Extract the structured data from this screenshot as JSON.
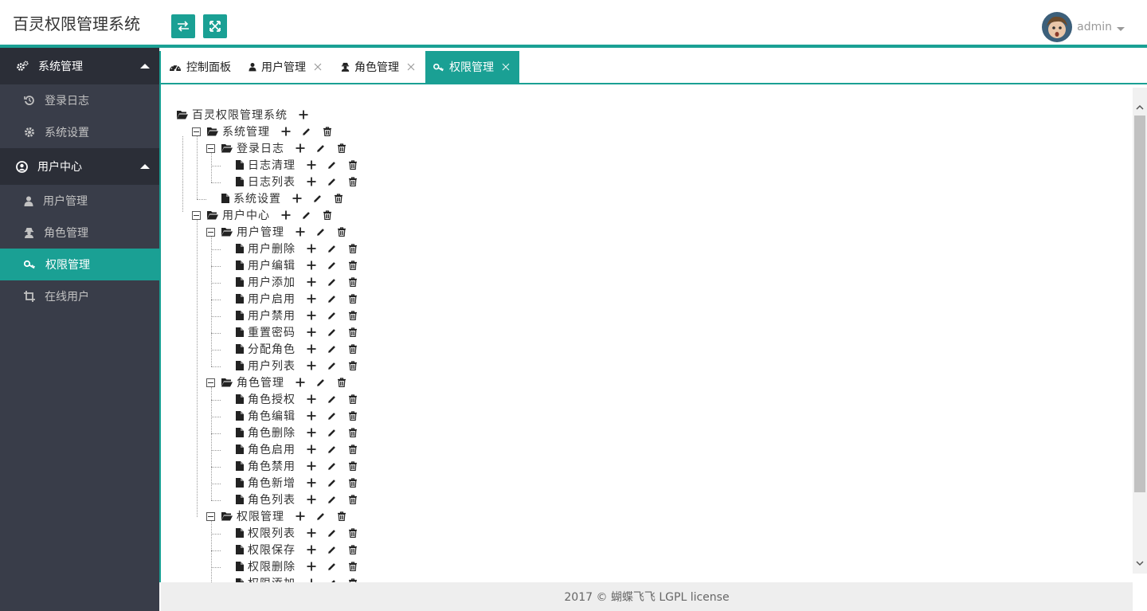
{
  "header": {
    "title": "百灵权限管理系统",
    "buttons": [
      {
        "icon": "swap-icon"
      },
      {
        "icon": "expand-icon"
      }
    ],
    "user": {
      "name": "admin"
    }
  },
  "sidebar": {
    "groups": [
      {
        "label": "系统管理",
        "icon": "cogs-icon",
        "items": [
          {
            "label": "登录日志",
            "icon": "history-icon"
          },
          {
            "label": "系统设置",
            "icon": "gear-icon"
          }
        ]
      },
      {
        "label": "用户中心",
        "icon": "user-circle-icon",
        "items": [
          {
            "label": "用户管理",
            "icon": "user-icon"
          },
          {
            "label": "角色管理",
            "icon": "user-secret-icon"
          },
          {
            "label": "权限管理",
            "icon": "key-icon",
            "active": true
          },
          {
            "label": "在线用户",
            "icon": "crop-icon"
          }
        ]
      }
    ]
  },
  "tabs": [
    {
      "label": "控制面板",
      "icon": "dashboard-icon",
      "closable": false
    },
    {
      "label": "用户管理",
      "icon": "user-icon",
      "closable": true
    },
    {
      "label": "角色管理",
      "icon": "user-secret-icon",
      "closable": true
    },
    {
      "label": "权限管理",
      "icon": "key-icon",
      "closable": true,
      "active": true
    }
  ],
  "tree": [
    {
      "label": "百灵权限管理系统",
      "type": "folder",
      "level": 0,
      "actions": [
        "add"
      ]
    },
    {
      "label": "系统管理",
      "type": "folder",
      "level": 1,
      "actions": [
        "add",
        "edit",
        "delete"
      ]
    },
    {
      "label": "登录日志",
      "type": "folder",
      "level": 2,
      "actions": [
        "add",
        "edit",
        "delete"
      ]
    },
    {
      "label": "日志清理",
      "type": "file",
      "level": 3,
      "actions": [
        "add",
        "edit",
        "delete"
      ]
    },
    {
      "label": "日志列表",
      "type": "file",
      "level": 3,
      "actions": [
        "add",
        "edit",
        "delete"
      ]
    },
    {
      "label": "系统设置",
      "type": "file",
      "level": 2,
      "actions": [
        "add",
        "edit",
        "delete"
      ]
    },
    {
      "label": "用户中心",
      "type": "folder",
      "level": 1,
      "actions": [
        "add",
        "edit",
        "delete"
      ]
    },
    {
      "label": "用户管理",
      "type": "folder",
      "level": 2,
      "actions": [
        "add",
        "edit",
        "delete"
      ]
    },
    {
      "label": "用户删除",
      "type": "file",
      "level": 3,
      "actions": [
        "add",
        "edit",
        "delete"
      ]
    },
    {
      "label": "用户编辑",
      "type": "file",
      "level": 3,
      "actions": [
        "add",
        "edit",
        "delete"
      ]
    },
    {
      "label": "用户添加",
      "type": "file",
      "level": 3,
      "actions": [
        "add",
        "edit",
        "delete"
      ]
    },
    {
      "label": "用户启用",
      "type": "file",
      "level": 3,
      "actions": [
        "add",
        "edit",
        "delete"
      ]
    },
    {
      "label": "用户禁用",
      "type": "file",
      "level": 3,
      "actions": [
        "add",
        "edit",
        "delete"
      ]
    },
    {
      "label": "重置密码",
      "type": "file",
      "level": 3,
      "actions": [
        "add",
        "edit",
        "delete"
      ]
    },
    {
      "label": "分配角色",
      "type": "file",
      "level": 3,
      "actions": [
        "add",
        "edit",
        "delete"
      ]
    },
    {
      "label": "用户列表",
      "type": "file",
      "level": 3,
      "actions": [
        "add",
        "edit",
        "delete"
      ]
    },
    {
      "label": "角色管理",
      "type": "folder",
      "level": 2,
      "actions": [
        "add",
        "edit",
        "delete"
      ]
    },
    {
      "label": "角色授权",
      "type": "file",
      "level": 3,
      "actions": [
        "add",
        "edit",
        "delete"
      ]
    },
    {
      "label": "角色编辑",
      "type": "file",
      "level": 3,
      "actions": [
        "add",
        "edit",
        "delete"
      ]
    },
    {
      "label": "角色删除",
      "type": "file",
      "level": 3,
      "actions": [
        "add",
        "edit",
        "delete"
      ]
    },
    {
      "label": "角色启用",
      "type": "file",
      "level": 3,
      "actions": [
        "add",
        "edit",
        "delete"
      ]
    },
    {
      "label": "角色禁用",
      "type": "file",
      "level": 3,
      "actions": [
        "add",
        "edit",
        "delete"
      ]
    },
    {
      "label": "角色新增",
      "type": "file",
      "level": 3,
      "actions": [
        "add",
        "edit",
        "delete"
      ]
    },
    {
      "label": "角色列表",
      "type": "file",
      "level": 3,
      "actions": [
        "add",
        "edit",
        "delete"
      ]
    },
    {
      "label": "权限管理",
      "type": "folder",
      "level": 2,
      "actions": [
        "add",
        "edit",
        "delete"
      ]
    },
    {
      "label": "权限列表",
      "type": "file",
      "level": 3,
      "actions": [
        "add",
        "edit",
        "delete"
      ]
    },
    {
      "label": "权限保存",
      "type": "file",
      "level": 3,
      "actions": [
        "add",
        "edit",
        "delete"
      ]
    },
    {
      "label": "权限删除",
      "type": "file",
      "level": 3,
      "actions": [
        "add",
        "edit",
        "delete"
      ]
    },
    {
      "label": "权限添加",
      "type": "file",
      "level": 3,
      "actions": [
        "add",
        "edit",
        "delete"
      ]
    }
  ],
  "footer": {
    "text": "2017 © 蝴蝶飞飞 LGPL license"
  },
  "colors": {
    "accent": "#1aa094",
    "sidebar_bg": "#393d49",
    "sidebar_group_bg": "#2b2e37"
  }
}
